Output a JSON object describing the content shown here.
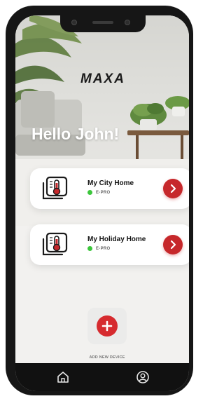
{
  "app": {
    "brand": "MAXA",
    "greeting": "Hello John!"
  },
  "devices": [
    {
      "name": "My City Home",
      "model": "E-PRO",
      "status_color": "#3cc63c",
      "icon": "thermostat-icon"
    },
    {
      "name": "My Holiday Home",
      "model": "E-PRO",
      "status_color": "#3cc63c",
      "icon": "thermostat-icon"
    }
  ],
  "add_device": {
    "label": "ADD NEW DEVICE",
    "icon": "plus-icon"
  },
  "tabbar": {
    "home_icon": "home-icon",
    "profile_icon": "user-icon"
  },
  "colors": {
    "accent": "#c6282b",
    "online": "#3cc63c",
    "tabbar": "#111111"
  }
}
